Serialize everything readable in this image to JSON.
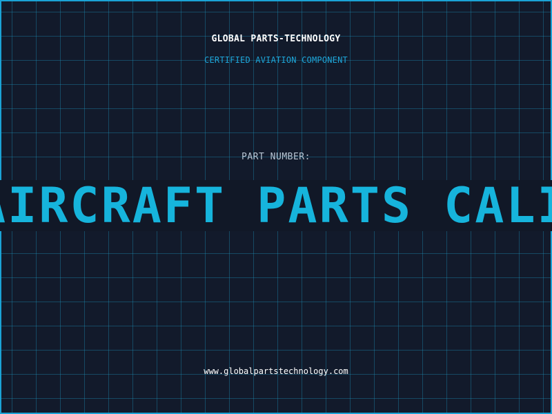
{
  "header": {
    "company": "GLOBAL PARTS-TECHNOLOGY",
    "tagline": "CERTIFIED AVIATION COMPONENT"
  },
  "part": {
    "label": "PART NUMBER:",
    "value": "AIRCRAFT PARTS CALI"
  },
  "footer": {
    "website": "www.globalpartstechnology.com"
  },
  "colors": {
    "background": "#121a2b",
    "grid": "#1e96be",
    "accent": "#16b4dc",
    "border": "#1ba3d6"
  }
}
